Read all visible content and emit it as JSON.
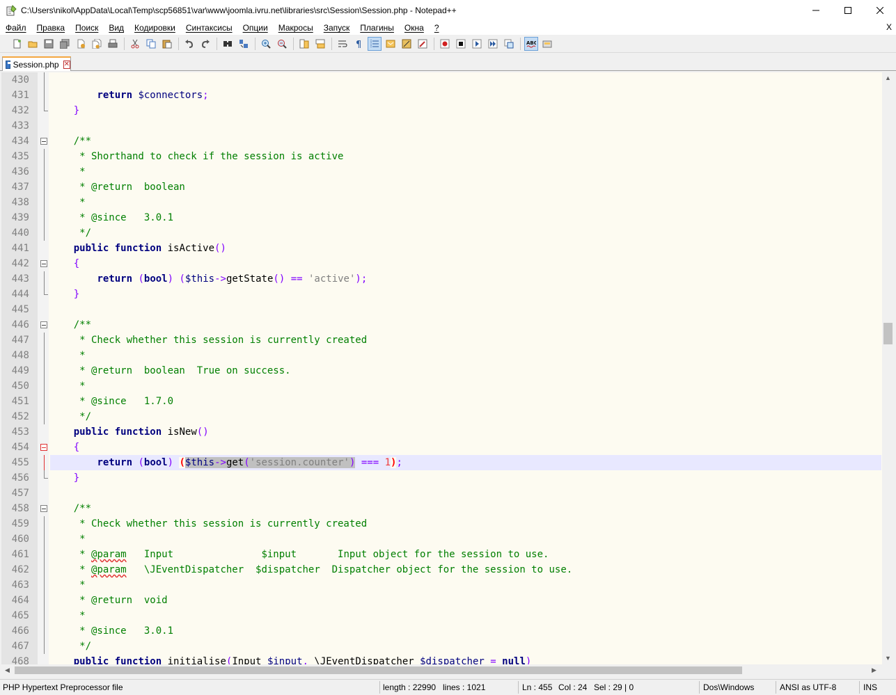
{
  "window": {
    "title": "C:\\Users\\nikol\\AppData\\Local\\Temp\\scp56851\\var\\www\\joomla.ivru.net\\libraries\\src\\Session\\Session.php - Notepad++",
    "minimize": "—",
    "maximize": "☐",
    "close": "✕"
  },
  "menu": {
    "items": [
      "Файл",
      "Правка",
      "Поиск",
      "Вид",
      "Кодировки",
      "Синтаксисы",
      "Опции",
      "Макросы",
      "Запуск",
      "Плагины",
      "Окна",
      "?"
    ],
    "close_doc": "X"
  },
  "tab": {
    "label": "Session.php",
    "close": "✕"
  },
  "status": {
    "file_type": "PHP Hypertext Preprocessor file",
    "length": "length : 22990",
    "lines": "lines : 1021",
    "ln": "Ln : 455",
    "col": "Col : 24",
    "sel": "Sel : 29 | 0",
    "eol": "Dos\\Windows",
    "encoding": "ANSI as UTF-8",
    "mode": "INS"
  },
  "editor": {
    "current_line": 455,
    "lines": [
      {
        "n": "430",
        "t": ""
      },
      {
        "n": "431",
        "t": "        return $connectors;"
      },
      {
        "n": "432",
        "t": "    }"
      },
      {
        "n": "433",
        "t": ""
      },
      {
        "n": "434",
        "t": "    /**"
      },
      {
        "n": "435",
        "t": "     * Shorthand to check if the session is active"
      },
      {
        "n": "436",
        "t": "     *"
      },
      {
        "n": "437",
        "t": "     * @return  boolean"
      },
      {
        "n": "438",
        "t": "     *"
      },
      {
        "n": "439",
        "t": "     * @since   3.0.1"
      },
      {
        "n": "440",
        "t": "     */"
      },
      {
        "n": "441",
        "t": "    public function isActive()"
      },
      {
        "n": "442",
        "t": "    {"
      },
      {
        "n": "443",
        "t": "        return (bool) ($this->getState() == 'active');"
      },
      {
        "n": "444",
        "t": "    }"
      },
      {
        "n": "445",
        "t": ""
      },
      {
        "n": "446",
        "t": "    /**"
      },
      {
        "n": "447",
        "t": "     * Check whether this session is currently created"
      },
      {
        "n": "448",
        "t": "     *"
      },
      {
        "n": "449",
        "t": "     * @return  boolean  True on success."
      },
      {
        "n": "450",
        "t": "     *"
      },
      {
        "n": "451",
        "t": "     * @since   1.7.0"
      },
      {
        "n": "452",
        "t": "     */"
      },
      {
        "n": "453",
        "t": "    public function isNew()"
      },
      {
        "n": "454",
        "t": "    {"
      },
      {
        "n": "455",
        "t": "        return (bool) ($this->get('session.counter') === 1);"
      },
      {
        "n": "456",
        "t": "    }"
      },
      {
        "n": "457",
        "t": ""
      },
      {
        "n": "458",
        "t": "    /**"
      },
      {
        "n": "459",
        "t": "     * Check whether this session is currently created"
      },
      {
        "n": "460",
        "t": "     *"
      },
      {
        "n": "461",
        "t": "     * @param   Input               $input       Input object for the session to use."
      },
      {
        "n": "462",
        "t": "     * @param   \\JEventDispatcher  $dispatcher  Dispatcher object for the session to use."
      },
      {
        "n": "463",
        "t": "     *"
      },
      {
        "n": "464",
        "t": "     * @return  void"
      },
      {
        "n": "465",
        "t": "     *"
      },
      {
        "n": "466",
        "t": "     * @since   3.0.1"
      },
      {
        "n": "467",
        "t": "     */"
      },
      {
        "n": "468",
        "t": "    public function initialise(Input $input, \\JEventDispatcher $dispatcher = null)"
      }
    ]
  },
  "toolbar": {
    "icons": [
      "new-file-icon",
      "open-file-icon",
      "save-icon",
      "save-all-icon",
      "close-icon",
      "close-all-icon",
      "print-icon",
      "cut-icon",
      "copy-icon",
      "paste-icon",
      "undo-icon",
      "redo-icon",
      "find-icon",
      "replace-icon",
      "zoom-in-icon",
      "zoom-out-icon",
      "sync-vertical-icon",
      "sync-horizontal-icon",
      "word-wrap-icon",
      "show-all-chars-icon",
      "indent-guide-icon",
      "doc-map-icon",
      "function-list-icon",
      "folder-workspace-icon",
      "record-macro-icon",
      "stop-record-icon",
      "play-macro-icon",
      "run-macro-multiple-icon",
      "save-macro-icon",
      "spell-check-icon",
      "plugin-icon"
    ],
    "active_color": "#c4dcf4"
  },
  "colors": {
    "keyword": "#00007f",
    "comment": "#007f00",
    "string": "#7f7f7f",
    "number": "#f03c3c",
    "operator": "#8000ff",
    "background": "#fdfbf1",
    "current_line": "#e8e8ff",
    "selection": "#c0c0c0"
  }
}
